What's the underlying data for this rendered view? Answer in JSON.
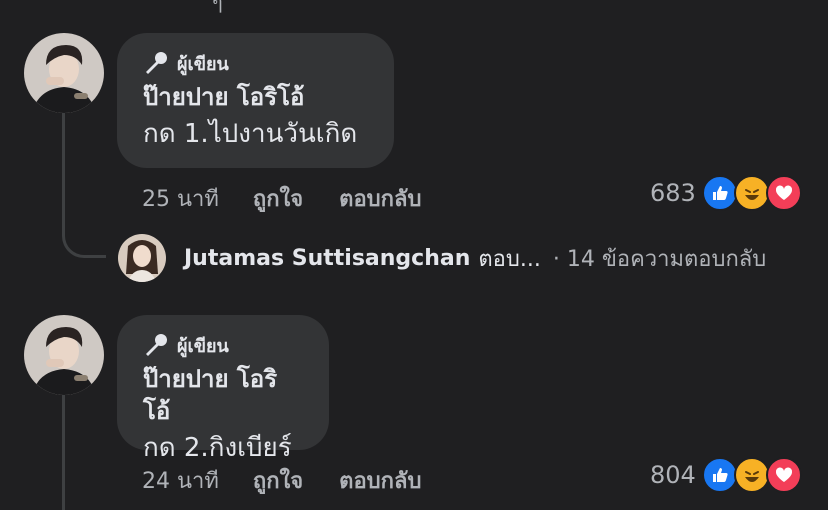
{
  "top_fragment": "ๆ",
  "comments": [
    {
      "badge": "ผู้เขียน",
      "author": "ป๊ายปาย โอริโอ้",
      "text": "กด 1.ไปงานวันเกิด",
      "time": "25 นาที",
      "like_label": "ถูกใจ",
      "reply_label": "ตอบกลับ",
      "reaction_count": "683",
      "reactions": [
        "like-icon",
        "haha-icon",
        "love-icon"
      ]
    },
    {
      "badge": "ผู้เขียน",
      "author": "ป๊ายปาย โอริโอ้",
      "text": "กด 2.กิงเบียร์",
      "time": "24 นาที",
      "like_label": "ถูกใจ",
      "reply_label": "ตอบกลับ",
      "reaction_count": "804",
      "reactions": [
        "like-icon",
        "haha-icon",
        "love-icon"
      ]
    }
  ],
  "reply_preview": {
    "name": "Jutamas Suttisangchan",
    "verb": "ตอบ...",
    "count_text": "· 14 ข้อความตอบกลับ"
  },
  "colors": {
    "background": "#1f1f21",
    "bubble": "#333436",
    "like_blue": "#1877f2",
    "love_red": "#f33e58",
    "haha_yellow": "#f7b125"
  }
}
